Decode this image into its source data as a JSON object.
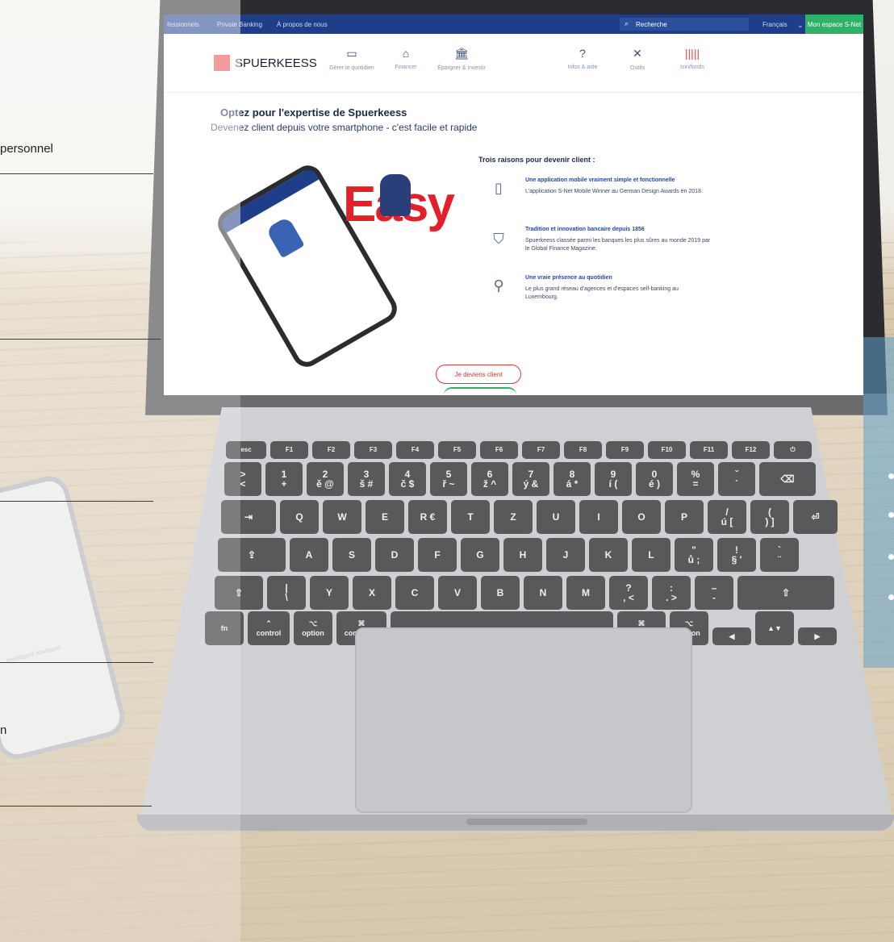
{
  "sidebar_labels": {
    "item1": "personnel",
    "item2": "n"
  },
  "site": {
    "topbar": {
      "link1": "fessionnels",
      "link2": "Private Banking",
      "link3": "À propos de nous",
      "search": "Recherche",
      "language": "Français",
      "espace": "Mon espace S-Net"
    },
    "logo": "SPUERKEESS",
    "nav": [
      {
        "icon": "wallet-icon",
        "label": "Gérer le quotidien",
        "glyph": "▭"
      },
      {
        "icon": "house-icon",
        "label": "Financer",
        "glyph": "⌂"
      },
      {
        "icon": "bank-icon",
        "label": "Épargner & investir",
        "glyph": "🏛"
      },
      {
        "icon": "help-icon",
        "label": "Infos & aide",
        "glyph": "?"
      },
      {
        "icon": "tools-icon",
        "label": "Outils",
        "glyph": "✕"
      },
      {
        "icon": "barcode-icon",
        "label": "Isin/fonds",
        "glyph": "|||||"
      }
    ],
    "headline": "Optez pour l'expertise de Spuerkeess",
    "subheadline": "Devenez client depuis votre smartphone - c'est facile et rapide",
    "easy_word": "Easy",
    "reasons_title": "Trois raisons pour devenir client :",
    "reasons": [
      {
        "icon": "phone-icon",
        "title": "Une application mobile vraiment simple et fonctionnelle",
        "desc": "L'application S-Net Mobile Winner au German Design Awards en 2018."
      },
      {
        "icon": "shield-icon",
        "title": "Tradition et innovation bancaire depuis 1856",
        "desc": "Spuerkeess classée parmi les banques les plus sûres au monde 2019 par le Global Finance Magazine."
      },
      {
        "icon": "location-pin-icon",
        "title": "Une vraie présence au quotidien",
        "desc": "Le plus grand réseau d'agences et d'espaces self-banking au Luxembourg."
      }
    ],
    "cta": "Je deviens client"
  },
  "keyboard": {
    "row_fn": [
      "esc",
      "F1",
      "F2",
      "F3",
      "F4",
      "F5",
      "F6",
      "F7",
      "F8",
      "F9",
      "F10",
      "F11",
      "F12",
      "⏻"
    ],
    "row1": [
      ">\n<",
      "1\n+",
      "2\ně @",
      "3\nš #",
      "4\nč $",
      "5\nř ~",
      "6\nž ^",
      "7\ný &",
      "8\ná *",
      "9\ní (",
      "0\né )",
      "%\n=",
      "ˇ\n´",
      "⌫"
    ],
    "row2": [
      "⇥",
      "Q",
      "W",
      "E",
      "R €",
      "T",
      "Z",
      "U",
      "I",
      "O",
      "P",
      "/\nú [",
      "(\n) ]",
      "⏎"
    ],
    "row3": [
      "⇪",
      "A",
      "S",
      "D",
      "F",
      "G",
      "H",
      "J",
      "K",
      "L",
      "\"\nů ;",
      "!\n§ '",
      "`\n¨"
    ],
    "row4": [
      "⇧",
      "|\n\\",
      "Y",
      "X",
      "C",
      "V",
      "B",
      "N",
      "M",
      "?\n, <",
      ":\n. >",
      "–\n-",
      "⇧"
    ],
    "row5": [
      "fn",
      "⌃\ncontrol",
      "⌥\noption",
      "⌘\ncommand",
      "",
      "⌘\ncommand",
      "⌥\noption",
      "◀",
      "▲▼",
      "▶"
    ]
  }
}
